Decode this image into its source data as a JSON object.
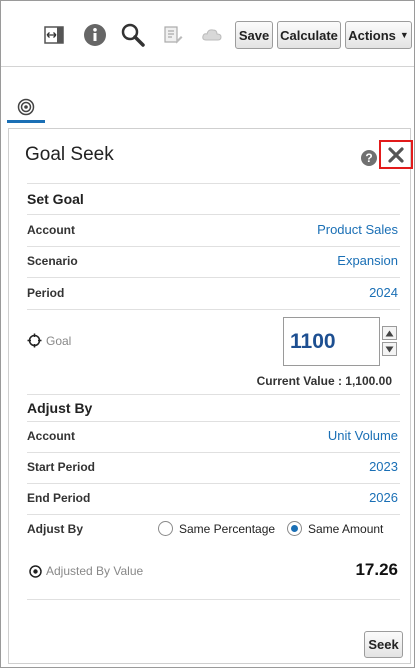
{
  "toolbar": {
    "icons": [
      "fit-width-icon",
      "info-icon",
      "search-icon",
      "edit-rules-icon",
      "cloud-icon"
    ],
    "save_label": "Save",
    "calculate_label": "Calculate",
    "actions_label": "Actions"
  },
  "panel": {
    "title": "Goal Seek",
    "set_goal": {
      "heading": "Set Goal",
      "rows": [
        {
          "label": "Account",
          "value": "Product Sales"
        },
        {
          "label": "Scenario",
          "value": "Expansion"
        },
        {
          "label": "Period",
          "value": "2024"
        }
      ],
      "goal_label": "Goal",
      "goal_value": "1100",
      "current_value": "Current Value : 1,100.00"
    },
    "adjust_by": {
      "heading": "Adjust By",
      "rows": [
        {
          "label": "Account",
          "value": "Unit Volume"
        },
        {
          "label": "Start Period",
          "value": "2023"
        },
        {
          "label": "End Period",
          "value": "2026"
        }
      ],
      "adjust_label": "Adjust By",
      "options": [
        {
          "label": "Same Percentage",
          "selected": false
        },
        {
          "label": "Same Amount",
          "selected": true
        }
      ],
      "adjusted_label": "Adjusted By Value",
      "adjusted_value": "17.26"
    },
    "seek_label": "Seek"
  },
  "colors": {
    "accent": "#1a6fb5",
    "close_border": "#e21b1b",
    "goal_text": "#1d4f91"
  }
}
